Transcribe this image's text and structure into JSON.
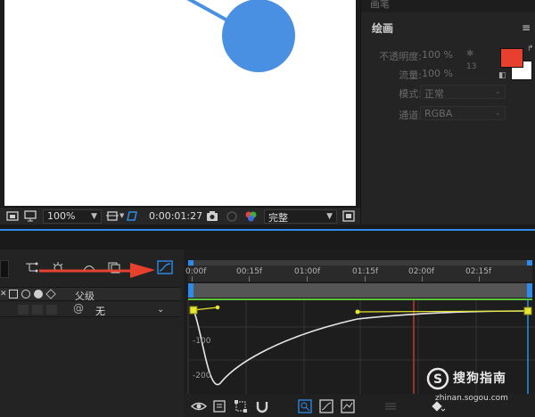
{
  "viewer": {
    "zoom": "100%",
    "timecode": "0:00:01:27",
    "resolution": "完整"
  },
  "paint_panel": {
    "top_label": "画笔",
    "title": "绘画",
    "menu_glyph": "≡",
    "opacity_label": "不透明度:",
    "opacity_value": "100 %",
    "flow_label": "流量:",
    "flow_value": "100 %",
    "brush_size": "13",
    "mode_label": "模式:",
    "mode_value": "正常",
    "channel_label": "通道:",
    "channel_value": "RGBA",
    "foreground_color": "#e8402f",
    "background_color": "#ffffff"
  },
  "timeline": {
    "parent_label": "父级",
    "parent_value": "无",
    "ruler_labels": [
      "0:00f",
      "00:15f",
      "01:00f",
      "01:15f",
      "02:00f",
      "02:15f"
    ],
    "graph_labels": [
      "-100",
      "-200"
    ]
  },
  "watermark": {
    "name": "搜狗指南",
    "url": "zhinan.sogou.com"
  },
  "colors": {
    "accent": "#2d8ceb",
    "arrow": "#e8402f",
    "circle": "#4a90e2",
    "curve_handle": "#e6e62e",
    "playhead": "#c0392b"
  }
}
